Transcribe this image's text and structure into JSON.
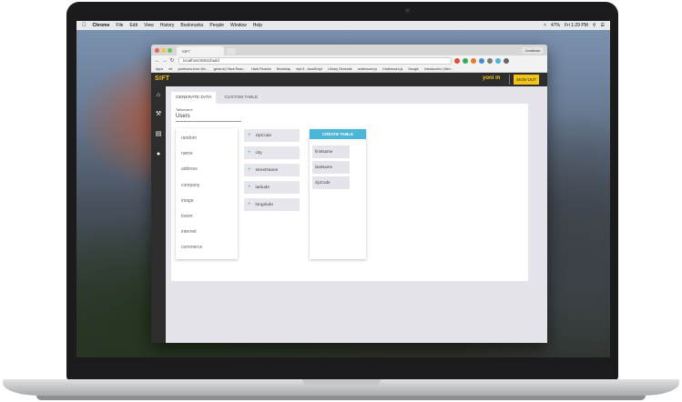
{
  "menubar": {
    "items": [
      "Chrome",
      "File",
      "Edit",
      "View",
      "History",
      "Bookmarks",
      "People",
      "Window",
      "Help"
    ],
    "status": [
      "47%",
      "Fri 1:29 PM"
    ]
  },
  "browser": {
    "tab_title": "SIFT",
    "profile": "Jonathan",
    "url": "localhost:5001/build",
    "bookmarks": [
      "Apps",
      "ntr",
      "yoniburns-from-Mo...",
      "general | Hack Reac...",
      "Hack Reactor",
      "Bootstrap",
      "repl.it - JavaScript",
      "Library Generals",
      "underscore.js",
      "Underscore.js",
      "Google",
      "Introduction | Meri..."
    ]
  },
  "app": {
    "logo": "SIFT",
    "username": "yoni m",
    "signout_label": "SIGN OUT",
    "tabs": [
      "GENERATE DATA",
      "CUSTOM TABLE"
    ],
    "table_name_label": "Tablename",
    "table_name_value": "Users",
    "categories": [
      "random",
      "name",
      "address",
      "company",
      "image",
      "lorem",
      "internet",
      "commerce"
    ],
    "fields": [
      "zipCode",
      "city",
      "streetName",
      "latitude",
      "longitude"
    ],
    "create_table_label": "CREATE TABLE",
    "table_fields": [
      "firstName",
      "lastName",
      "zipCode"
    ],
    "accent_color": "#f0c419",
    "button_color": "#4bb6d5"
  }
}
